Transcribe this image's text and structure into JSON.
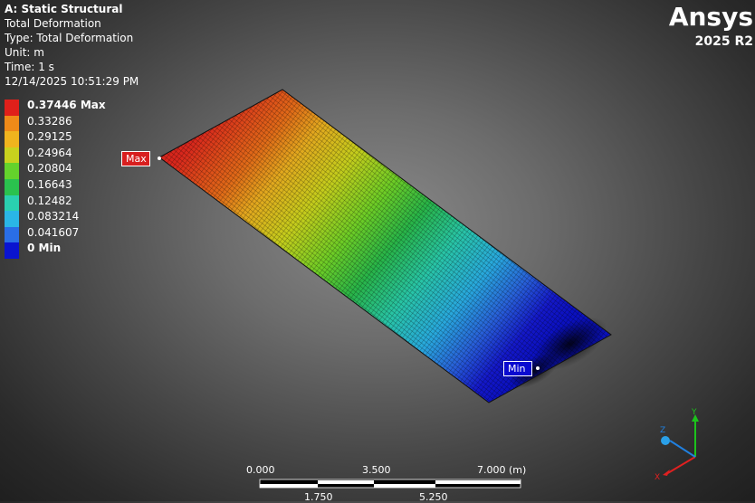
{
  "info": {
    "title": "A: Static Structural",
    "result": "Total Deformation",
    "type": "Type: Total Deformation",
    "unit": "Unit: m",
    "time": "Time: 1 s",
    "date": "12/14/2025 10:51:29 PM"
  },
  "legend": {
    "items": [
      {
        "label": "0.37446 Max",
        "color": "#e0201a",
        "bold": true
      },
      {
        "label": "0.33286",
        "color": "#ef8a18",
        "bold": false
      },
      {
        "label": "0.29125",
        "color": "#f0b41e",
        "bold": false
      },
      {
        "label": "0.24964",
        "color": "#c8d21e",
        "bold": false
      },
      {
        "label": "0.20804",
        "color": "#64d22c",
        "bold": false
      },
      {
        "label": "0.16643",
        "color": "#2ac24e",
        "bold": false
      },
      {
        "label": "0.12482",
        "color": "#2ad0b0",
        "bold": false
      },
      {
        "label": "0.083214",
        "color": "#2ab6e6",
        "bold": false
      },
      {
        "label": "0.041607",
        "color": "#2a6ee6",
        "bold": false
      },
      {
        "label": "0 Min",
        "color": "#0a14d0",
        "bold": true
      }
    ]
  },
  "logo": {
    "brand": "Ansys",
    "version": "2025 R2"
  },
  "probes": {
    "max": "Max",
    "min": "Min"
  },
  "scale": {
    "top_labels": [
      "0.000",
      "3.500",
      "7.000 (m)"
    ],
    "bottom_labels": [
      "1.750",
      "5.250"
    ]
  },
  "triad": {
    "x": "X",
    "y": "Y",
    "z": "Z"
  }
}
